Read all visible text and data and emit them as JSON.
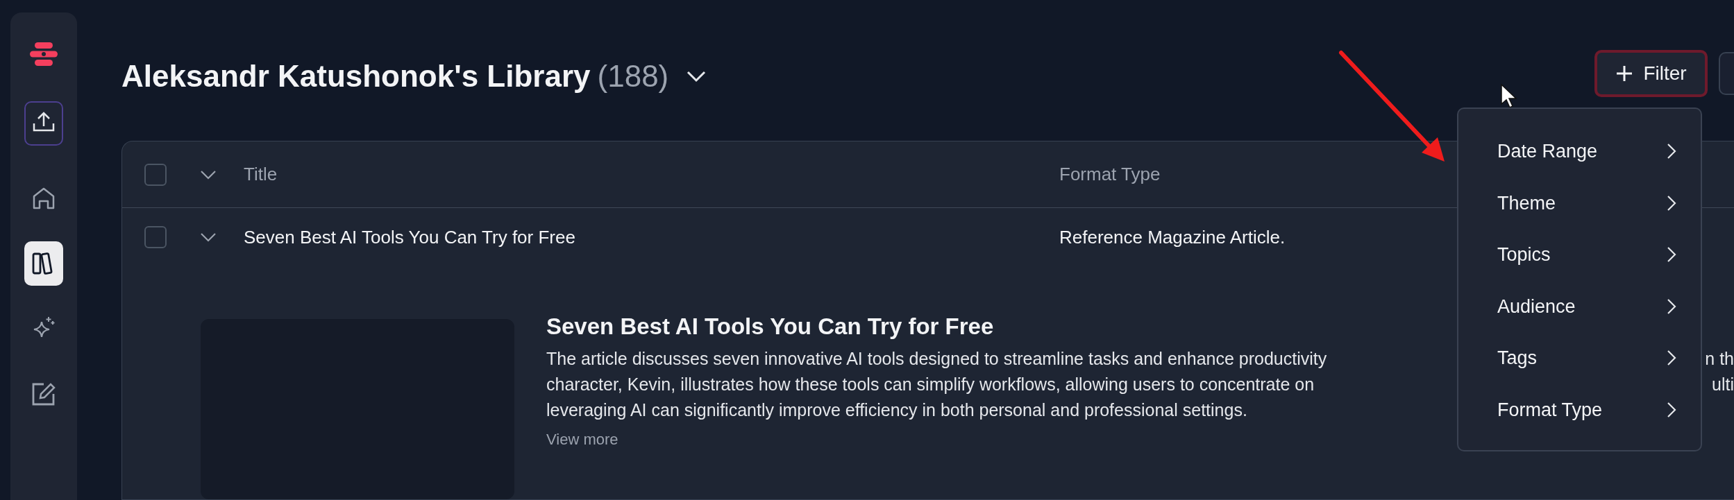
{
  "sidebar": {
    "items": [
      {
        "kind": "upload",
        "selected": false
      },
      {
        "kind": "home",
        "selected": false
      },
      {
        "kind": "library",
        "selected": true
      },
      {
        "kind": "sparkle",
        "selected": false
      },
      {
        "kind": "edit",
        "selected": false
      }
    ]
  },
  "header": {
    "title": "Aleksandr Katushonok's Library",
    "count": "(188)",
    "filter_button": "Filter"
  },
  "table": {
    "columns": [
      "Title",
      "Format Type"
    ],
    "header_checked": false,
    "rows": [
      {
        "checked": false,
        "expanded": true,
        "title": "Seven Best AI Tools You Can Try for Free",
        "format_type": "Reference Magazine Article.",
        "detail": {
          "heading": "Seven Best AI Tools You Can Try for Free",
          "lines": [
            {
              "text": "The article discusses seven innovative AI tools designed to streamline tasks and enhance productivity",
              "tail": "n th"
            },
            {
              "text": "character, Kevin, illustrates how these tools can simplify workflows, allowing users to concentrate on",
              "tail": "ulti"
            },
            {
              "text": "leveraging AI can significantly improve efficiency in both personal and professional settings."
            }
          ],
          "link": "View more"
        }
      }
    ]
  },
  "filter_menu": {
    "items": [
      "Date Range",
      "Theme",
      "Topics",
      "Audience",
      "Tags",
      "Format Type"
    ]
  }
}
